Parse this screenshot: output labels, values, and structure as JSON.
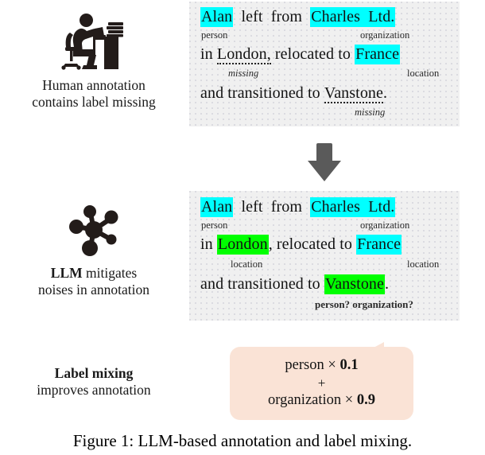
{
  "figure": {
    "caption": "Figure 1: LLM-based annotation and label mixing."
  },
  "colors": {
    "highlight_person": "#00ffff",
    "highlight_organization": "#00ffff",
    "highlight_location_cyan": "#00ffff",
    "highlight_llm_green": "#00ff00",
    "panel_background": "#f0f0f0",
    "callout_background": "#fae3d6",
    "arrow": "#5a5a5a",
    "icon": "#231c1a"
  },
  "rows": [
    {
      "id": "human-annotation",
      "icon_name": "person-at-desk-icon",
      "caption_line1": "Human annotation",
      "caption_line2": "contains label missing",
      "caption_bold_word": ""
    },
    {
      "id": "llm-annotation",
      "icon_name": "network-nodes-icon",
      "caption_line1_bold": "LLM",
      "caption_line1_rest": " mitigates",
      "caption_line2": "noises in annotation"
    },
    {
      "id": "label-mixing",
      "caption_line1_bold": "Label mixing",
      "caption_line2": "improves annotation"
    }
  ],
  "panel_human": {
    "line1": {
      "e1": "Alan",
      "t1": "left",
      "t2": "from",
      "e2": "Charles",
      "e3": "Ltd.",
      "tag_person": "person",
      "tag_organization": "organization"
    },
    "line2": {
      "t1": "in",
      "e1": "London",
      "t2": ",",
      "t3": "relocated",
      "t4": "to",
      "e2": "France",
      "tag_missing": "missing",
      "tag_location": "location"
    },
    "line3": {
      "t1": "and transitioned to",
      "e1": "Vanstone",
      "t2": ".",
      "tag_missing": "missing"
    }
  },
  "panel_llm": {
    "line1": {
      "e1": "Alan",
      "t1": "left",
      "t2": "from",
      "e2": "Charles",
      "e3": "Ltd.",
      "tag_person": "person",
      "tag_organization": "organization"
    },
    "line2": {
      "t1": "in",
      "e1": "London",
      "t2": ",",
      "t3": "relocated",
      "t4": "to",
      "e2": "France",
      "tag_location_left": "location",
      "tag_location_right": "location"
    },
    "line3": {
      "t1": "and transitioned to",
      "e1": "Vanstone",
      "t2": ".",
      "tag_question": "person? organization?"
    }
  },
  "mixing": {
    "label1": "person",
    "times1": "×",
    "weight1": "0.1",
    "plus": "+",
    "label2": "organization",
    "times2": "×",
    "weight2": "0.9"
  }
}
